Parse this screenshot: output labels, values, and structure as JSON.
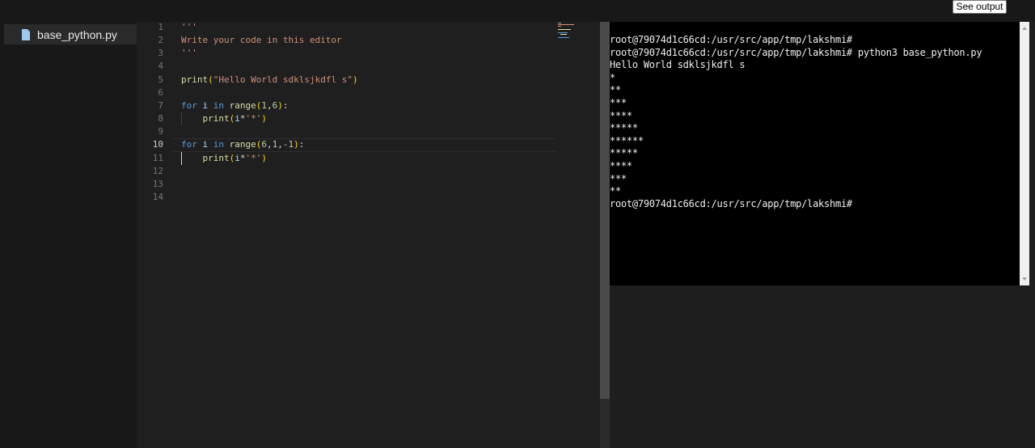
{
  "toolbar": {
    "see_output_label": "See output"
  },
  "sidebar": {
    "files": [
      {
        "name": "base_python.py",
        "icon": "file-icon"
      }
    ]
  },
  "editor": {
    "active_line": 10,
    "line_numbers": [
      "1",
      "2",
      "3",
      "4",
      "5",
      "6",
      "7",
      "8",
      "9",
      "10",
      "11",
      "12",
      "13",
      "14"
    ],
    "lines": [
      [
        {
          "t": "'''",
          "c": "str"
        }
      ],
      [
        {
          "t": "Write your code in this editor",
          "c": "str"
        }
      ],
      [
        {
          "t": "'''",
          "c": "str"
        }
      ],
      [],
      [
        {
          "t": "print",
          "c": "fn"
        },
        {
          "t": "(",
          "c": "p1"
        },
        {
          "t": "\"Hello World sdklsjkdfl s\"",
          "c": "str"
        },
        {
          "t": ")",
          "c": "p1"
        }
      ],
      [],
      [
        {
          "t": "for",
          "c": "kw"
        },
        {
          "t": " ",
          "c": "txt"
        },
        {
          "t": "i",
          "c": "var"
        },
        {
          "t": " ",
          "c": "txt"
        },
        {
          "t": "in",
          "c": "kw"
        },
        {
          "t": " ",
          "c": "txt"
        },
        {
          "t": "range",
          "c": "fn"
        },
        {
          "t": "(",
          "c": "p1"
        },
        {
          "t": "1",
          "c": "num"
        },
        {
          "t": ",",
          "c": "txt"
        },
        {
          "t": "6",
          "c": "num"
        },
        {
          "t": ")",
          "c": "p1"
        },
        {
          "t": ":",
          "c": "txt"
        }
      ],
      [
        {
          "t": "    ",
          "c": "txt"
        },
        {
          "t": "print",
          "c": "fn"
        },
        {
          "t": "(",
          "c": "p1"
        },
        {
          "t": "i",
          "c": "var"
        },
        {
          "t": "*",
          "c": "txt"
        },
        {
          "t": "'*'",
          "c": "str"
        },
        {
          "t": ")",
          "c": "p1"
        }
      ],
      [],
      [
        {
          "t": "for",
          "c": "kw"
        },
        {
          "t": " ",
          "c": "txt"
        },
        {
          "t": "i",
          "c": "var"
        },
        {
          "t": " ",
          "c": "txt"
        },
        {
          "t": "in",
          "c": "kw"
        },
        {
          "t": " ",
          "c": "txt"
        },
        {
          "t": "range",
          "c": "fn"
        },
        {
          "t": "(",
          "c": "p1"
        },
        {
          "t": "6",
          "c": "num"
        },
        {
          "t": ",",
          "c": "txt"
        },
        {
          "t": "1",
          "c": "num"
        },
        {
          "t": ",",
          "c": "txt"
        },
        {
          "t": "-1",
          "c": "num"
        },
        {
          "t": ")",
          "c": "p1"
        },
        {
          "t": ":",
          "c": "txt"
        }
      ],
      [
        {
          "t": "    ",
          "c": "txt"
        },
        {
          "t": "print",
          "c": "fn"
        },
        {
          "t": "(",
          "c": "p1"
        },
        {
          "t": "i",
          "c": "var"
        },
        {
          "t": "*",
          "c": "txt"
        },
        {
          "t": "'*'",
          "c": "str"
        },
        {
          "t": ")",
          "c": "p1"
        }
      ],
      [],
      [],
      []
    ]
  },
  "terminal": {
    "lines": [
      "root@79074d1c66cd:/usr/src/app/tmp/lakshmi#",
      "root@79074d1c66cd:/usr/src/app/tmp/lakshmi# python3 base_python.py",
      "Hello World sdklsjkdfl s",
      "*",
      "**",
      "***",
      "****",
      "*****",
      "******",
      "*****",
      "****",
      "***",
      "**",
      "root@79074d1c66cd:/usr/src/app/tmp/lakshmi#"
    ]
  },
  "colors": {
    "string": "#ce9178",
    "keyword": "#569cd6",
    "function": "#dcdcaa",
    "number": "#b5cea8",
    "variable": "#9cdcfe",
    "bracket": "#ffd700",
    "terminal_bg": "#000000",
    "editor_bg": "#1f1f1f"
  }
}
